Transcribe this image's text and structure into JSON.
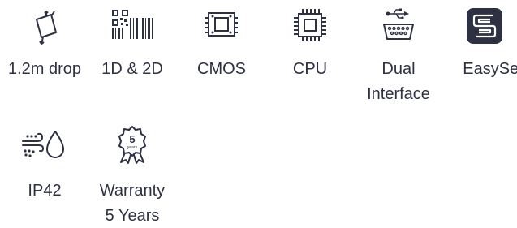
{
  "features": [
    {
      "label": "1.2m drop",
      "icon": "drop-test-icon"
    },
    {
      "label": "1D & 2D",
      "icon": "barcode-qr-icon"
    },
    {
      "label": "CMOS",
      "icon": "cmos-sensor-icon"
    },
    {
      "label": "CPU",
      "icon": "cpu-chip-icon"
    },
    {
      "label_lines": [
        "Dual",
        "Interface"
      ],
      "icon": "usb-serial-icon"
    },
    {
      "label": "EasySet",
      "icon": "easyset-logo-icon"
    },
    {
      "label": "IP42",
      "icon": "water-dust-icon"
    },
    {
      "label_lines": [
        "Warranty",
        "5 Years"
      ],
      "icon": "warranty-badge-icon",
      "badge_text": "5",
      "badge_sub": "years"
    }
  ],
  "colors": {
    "icon_dark": "#2e3142",
    "text": "#2e3142"
  }
}
